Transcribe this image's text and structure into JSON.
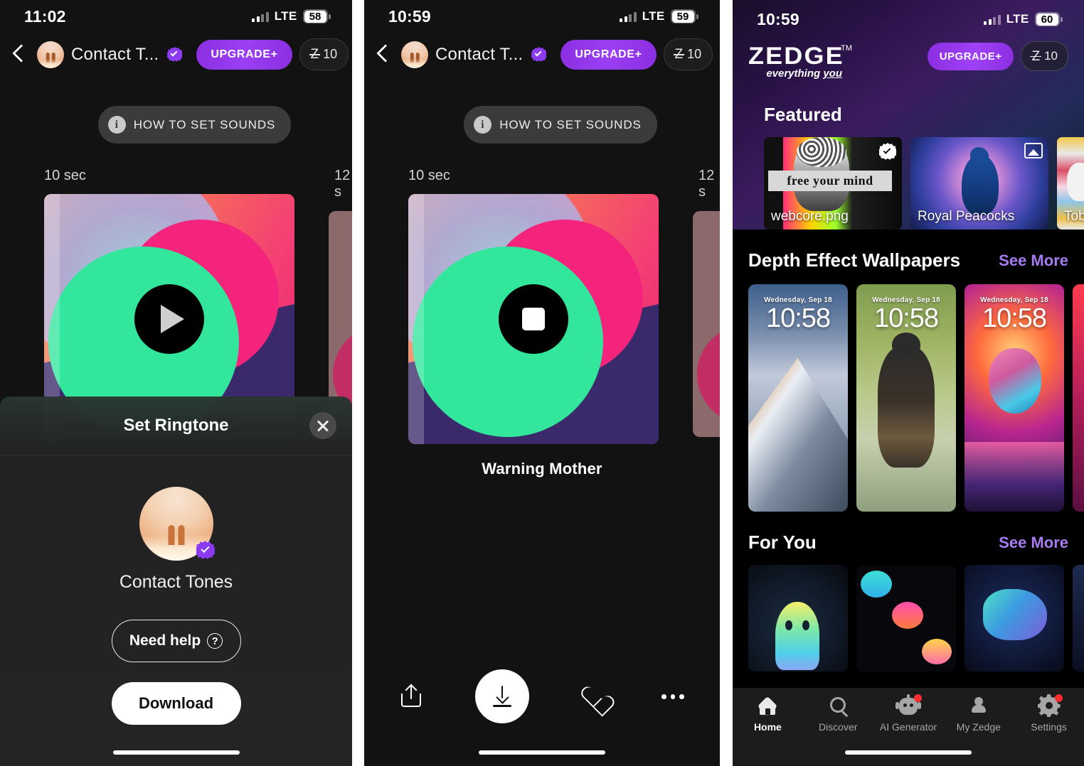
{
  "panel1": {
    "status": {
      "time": "11:02",
      "network": "LTE",
      "battery": "58"
    },
    "appbar": {
      "contact_name": "Contact T...",
      "upgrade_label": "UPGRADE+",
      "credits_value": "10",
      "back_icon": "back-chevron-icon",
      "verified_icon": "verified-badge-icon"
    },
    "howto_label": "HOW TO SET SOUNDS",
    "carousel": {
      "duration_current": "10 sec",
      "duration_next": "12 s"
    },
    "sheet": {
      "title": "Set Ringtone",
      "close_icon": "close-icon",
      "item_label": "Contact Tones",
      "need_help_label": "Need help",
      "help_icon": "question-mark-icon",
      "download_label": "Download"
    }
  },
  "panel2": {
    "status": {
      "time": "10:59",
      "network": "LTE",
      "battery": "59"
    },
    "appbar": {
      "contact_name": "Contact T...",
      "upgrade_label": "UPGRADE+",
      "credits_value": "10"
    },
    "howto_label": "HOW TO SET SOUNDS",
    "carousel": {
      "duration_current": "10 sec",
      "duration_next": "12 s"
    },
    "track_title": "Warning Mother",
    "actions": {
      "share_icon": "share-icon",
      "download_icon": "download-icon",
      "favorite_icon": "heart-icon",
      "more_icon": "more-options-icon"
    }
  },
  "panel3": {
    "status": {
      "time": "10:59",
      "network": "LTE",
      "battery": "60"
    },
    "brand": {
      "wordmark": "ZEDGE",
      "trademark": "TM",
      "tagline_pre": "everything ",
      "tagline_underline": "you"
    },
    "header_actions": {
      "upgrade_label": "UPGRADE+",
      "credits_value": "10"
    },
    "sections": [
      {
        "title": "Featured",
        "see_more": "",
        "cards": [
          {
            "caption": "webcore.png",
            "banner_text": "free your mind",
            "badge": "verified-badge-icon"
          },
          {
            "caption": "Royal Peacocks",
            "badge": "image-badge-icon"
          },
          {
            "caption": "Tobe",
            "badge": ""
          }
        ]
      },
      {
        "title": "Depth Effect Wallpapers",
        "see_more": "See More",
        "lockscreens": [
          {
            "date": "Wednesday, Sep 18",
            "time": "10:58",
            "subject": "mountain"
          },
          {
            "date": "Wednesday, Sep 18",
            "time": "10:58",
            "subject": "dog"
          },
          {
            "date": "Wednesday, Sep 18",
            "time": "10:58",
            "subject": "girl"
          }
        ]
      },
      {
        "title": "For You",
        "see_more": "See More",
        "cards": [
          {
            "subject": "rainbow-ghost"
          },
          {
            "subject": "neon-pumpkins"
          },
          {
            "subject": "neon-dinosaurs"
          }
        ]
      }
    ],
    "tabbar": [
      {
        "label": "Home",
        "icon": "home-icon",
        "active": true,
        "badge": false
      },
      {
        "label": "Discover",
        "icon": "search-icon",
        "active": false,
        "badge": false
      },
      {
        "label": "AI Generator",
        "icon": "robot-icon",
        "active": false,
        "badge": true
      },
      {
        "label": "My Zedge",
        "icon": "person-icon",
        "active": false,
        "badge": false
      },
      {
        "label": "Settings",
        "icon": "gear-icon",
        "active": false,
        "badge": true
      }
    ]
  },
  "colors": {
    "accent_purple": "#8b2ee0",
    "see_more": "#a77bf0",
    "badge_red": "#ff2d2d",
    "panel_bg": "#121212"
  }
}
